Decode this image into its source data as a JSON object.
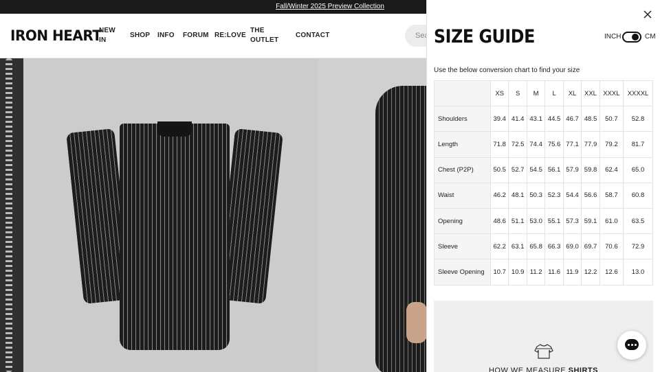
{
  "announcement": "Fall/Winter 2025 Preview Collection",
  "header": {
    "logo": "IRON HEART",
    "nav": [
      {
        "line1": "NEW",
        "line2": "IN"
      },
      {
        "line1": "SHOP",
        "line2": ""
      },
      {
        "line1": "INFO",
        "line2": ""
      },
      {
        "line1": "FORUM",
        "line2": ""
      },
      {
        "line1": "RE:LOVE",
        "line2": ""
      },
      {
        "line1": "THE",
        "line2": "OUTLET"
      },
      {
        "line1": "CONTACT",
        "line2": ""
      }
    ],
    "search_placeholder": "Sea"
  },
  "size_guide": {
    "title": "SIZE GUIDE",
    "unit_inch": "INCH",
    "unit_cm": "CM",
    "selected_unit": "CM",
    "intro": "Use the below conversion chart to find your size",
    "columns": [
      "XS",
      "S",
      "M",
      "L",
      "XL",
      "XXL",
      "XXXL",
      "XXXXL"
    ],
    "rows": [
      {
        "label": "Shoulders",
        "values": [
          "39.4",
          "41.4",
          "43.1",
          "44.5",
          "46.7",
          "48.5",
          "50.7",
          "52.8"
        ]
      },
      {
        "label": "Length",
        "values": [
          "71.8",
          "72.5",
          "74.4",
          "75.6",
          "77.1",
          "77.9",
          "79.2",
          "81.7"
        ]
      },
      {
        "label": "Chest (P2P)",
        "values": [
          "50.5",
          "52.7",
          "54.5",
          "56.1",
          "57.9",
          "59.8",
          "62.4",
          "65.0"
        ]
      },
      {
        "label": "Waist",
        "values": [
          "46.2",
          "48.1",
          "50.3",
          "52.3",
          "54.4",
          "56.6",
          "58.7",
          "60.8"
        ]
      },
      {
        "label": "Opening",
        "values": [
          "48.6",
          "51.1",
          "53.0",
          "55.1",
          "57.3",
          "59.1",
          "61.0",
          "63.5"
        ]
      },
      {
        "label": "Sleeve",
        "values": [
          "62.2",
          "63.1",
          "65.8",
          "66.3",
          "69.0",
          "69.7",
          "70.6",
          "72.9"
        ]
      },
      {
        "label": "Sleeve Opening",
        "values": [
          "10.7",
          "10.9",
          "11.2",
          "11.6",
          "11.9",
          "12.2",
          "12.6",
          "13.0"
        ]
      }
    ],
    "measure_prefix": "HOW WE MEASURE ",
    "measure_bold": "SHIRTS"
  },
  "icons": {
    "close": "close-icon",
    "chat": "chat-icon",
    "measure": "shirt-icon"
  },
  "colors": {
    "announcement_bg": "#1a1a1a",
    "text": "#222222",
    "measure_bg": "#efefef"
  }
}
